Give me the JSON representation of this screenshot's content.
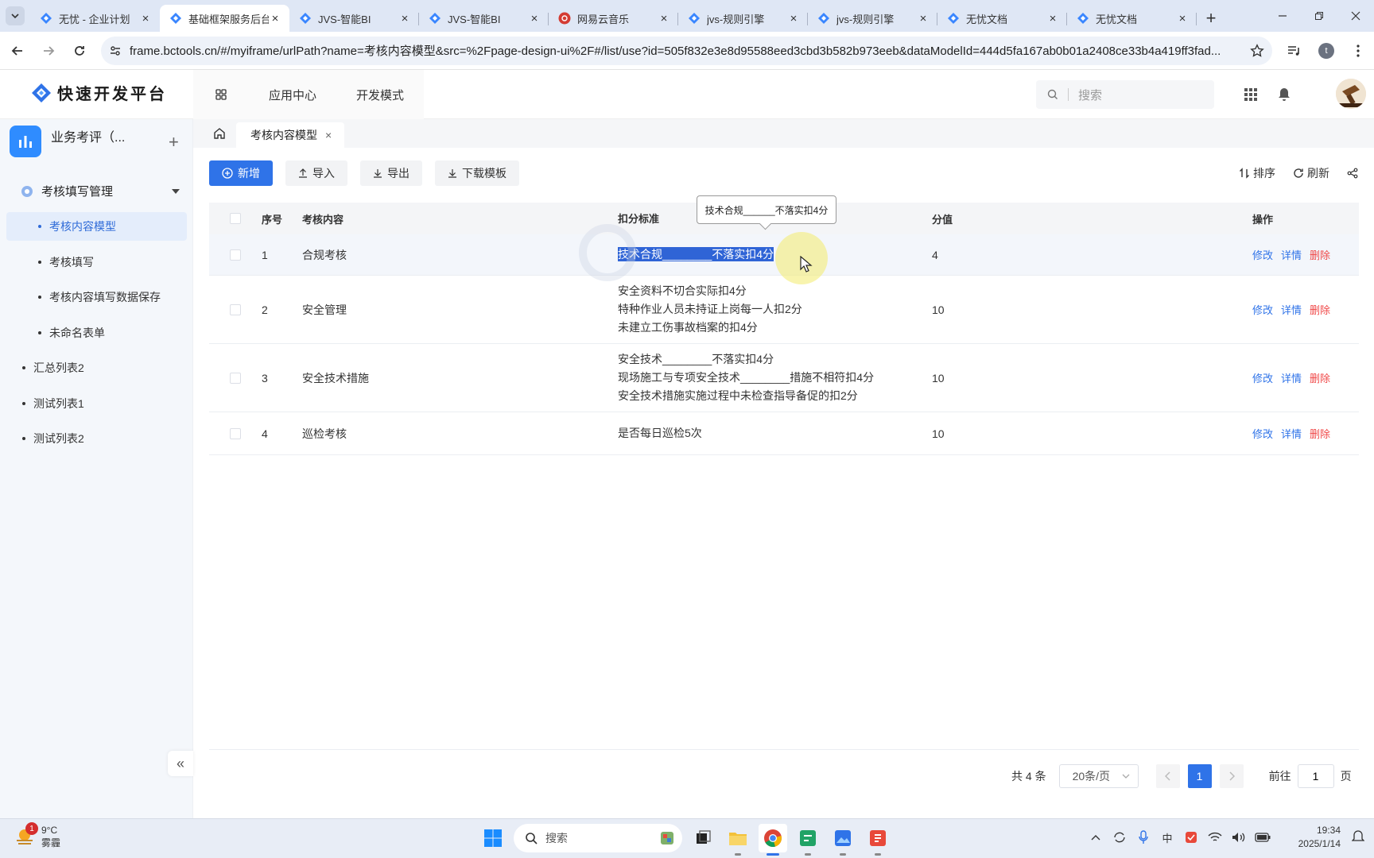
{
  "browser": {
    "tabs": [
      {
        "title": "无忧 - 企业计划",
        "icon": "jvs-logo-icon"
      },
      {
        "title": "基础框架服务后台",
        "icon": "jvs-logo-icon",
        "active": true
      },
      {
        "title": "JVS-智能BI",
        "icon": "jvs-logo-icon"
      },
      {
        "title": "JVS-智能BI",
        "icon": "jvs-logo-icon"
      },
      {
        "title": "网易云音乐",
        "icon": "netease-music-icon"
      },
      {
        "title": "jvs-规则引擎",
        "icon": "jvs-logo-icon"
      },
      {
        "title": "jvs-规则引擎",
        "icon": "jvs-logo-icon"
      },
      {
        "title": "无忧文档",
        "icon": "jvs-logo-icon"
      },
      {
        "title": "无忧文档",
        "icon": "jvs-logo-icon"
      }
    ],
    "url": "frame.bctools.cn/#/myiframe/urlPath?name=考核内容模型&src=%2Fpage-design-ui%2F#/list/use?id=505f832e3e8d95588eed3cbd3b582b973eeb&dataModelId=444d5fa167ab0b01a2408ce33b4a419ff3fad...",
    "profile_initial": "t"
  },
  "header": {
    "logo_text": "快速开发平台",
    "nav": [
      "应用中心",
      "开发模式"
    ],
    "search_placeholder": "搜索"
  },
  "sidebar": {
    "app_name": "业务考评（...",
    "group_label": "考核填写管理",
    "sub_items": [
      "考核内容模型",
      "考核填写",
      "考核内容填写数据保存",
      "未命名表单"
    ],
    "top_items": [
      "汇总列表2",
      "测试列表1",
      "测试列表2"
    ],
    "collapse_label": "«"
  },
  "page_tabs": {
    "current": "考核内容模型",
    "close": "×"
  },
  "toolbar": {
    "add": "新增",
    "import": "导入",
    "export": "导出",
    "download_template": "下载模板",
    "sort": "排序",
    "refresh": "刷新"
  },
  "table": {
    "headers": [
      "序号",
      "考核内容",
      "扣分标准",
      "分值",
      "操作"
    ],
    "rows": [
      {
        "no": "1",
        "content": "合规考核",
        "standards": [
          "技术合规________不落实扣4分"
        ],
        "score": "4"
      },
      {
        "no": "2",
        "content": "安全管理",
        "standards": [
          "安全资料不切合实际扣4分",
          "特种作业人员未持证上岗每一人扣2分",
          "未建立工伤事故档案的扣4分"
        ],
        "score": "10"
      },
      {
        "no": "3",
        "content": "安全技术措施",
        "standards": [
          "安全技术________不落实扣4分",
          "现场施工与专项安全技术________措施不相符扣4分",
          "安全技术措施实施过程中未检查指导备促的扣2分"
        ],
        "score": "10"
      },
      {
        "no": "4",
        "content": "巡检考核",
        "standards": [
          "是否每日巡检5次"
        ],
        "score": "10"
      }
    ],
    "ops": {
      "edit": "修改",
      "detail": "详情",
      "delete": "删除"
    },
    "tooltip": "技术合规______不落实扣4分"
  },
  "pagination": {
    "total": "共 4 条",
    "page_size": "20条/页",
    "current_page": "1",
    "goto_label": "前往",
    "goto_value": "1",
    "page_unit": "页"
  },
  "taskbar": {
    "weather_temp": "9°C",
    "weather_desc": "雾霾",
    "weather_badge": "1",
    "search_placeholder": "搜索",
    "time": "19:34",
    "date": "2025/1/14",
    "ime": "中"
  },
  "colors": {
    "primary": "#2f73e8",
    "danger": "#f04848",
    "selection": "#2f64d6"
  }
}
